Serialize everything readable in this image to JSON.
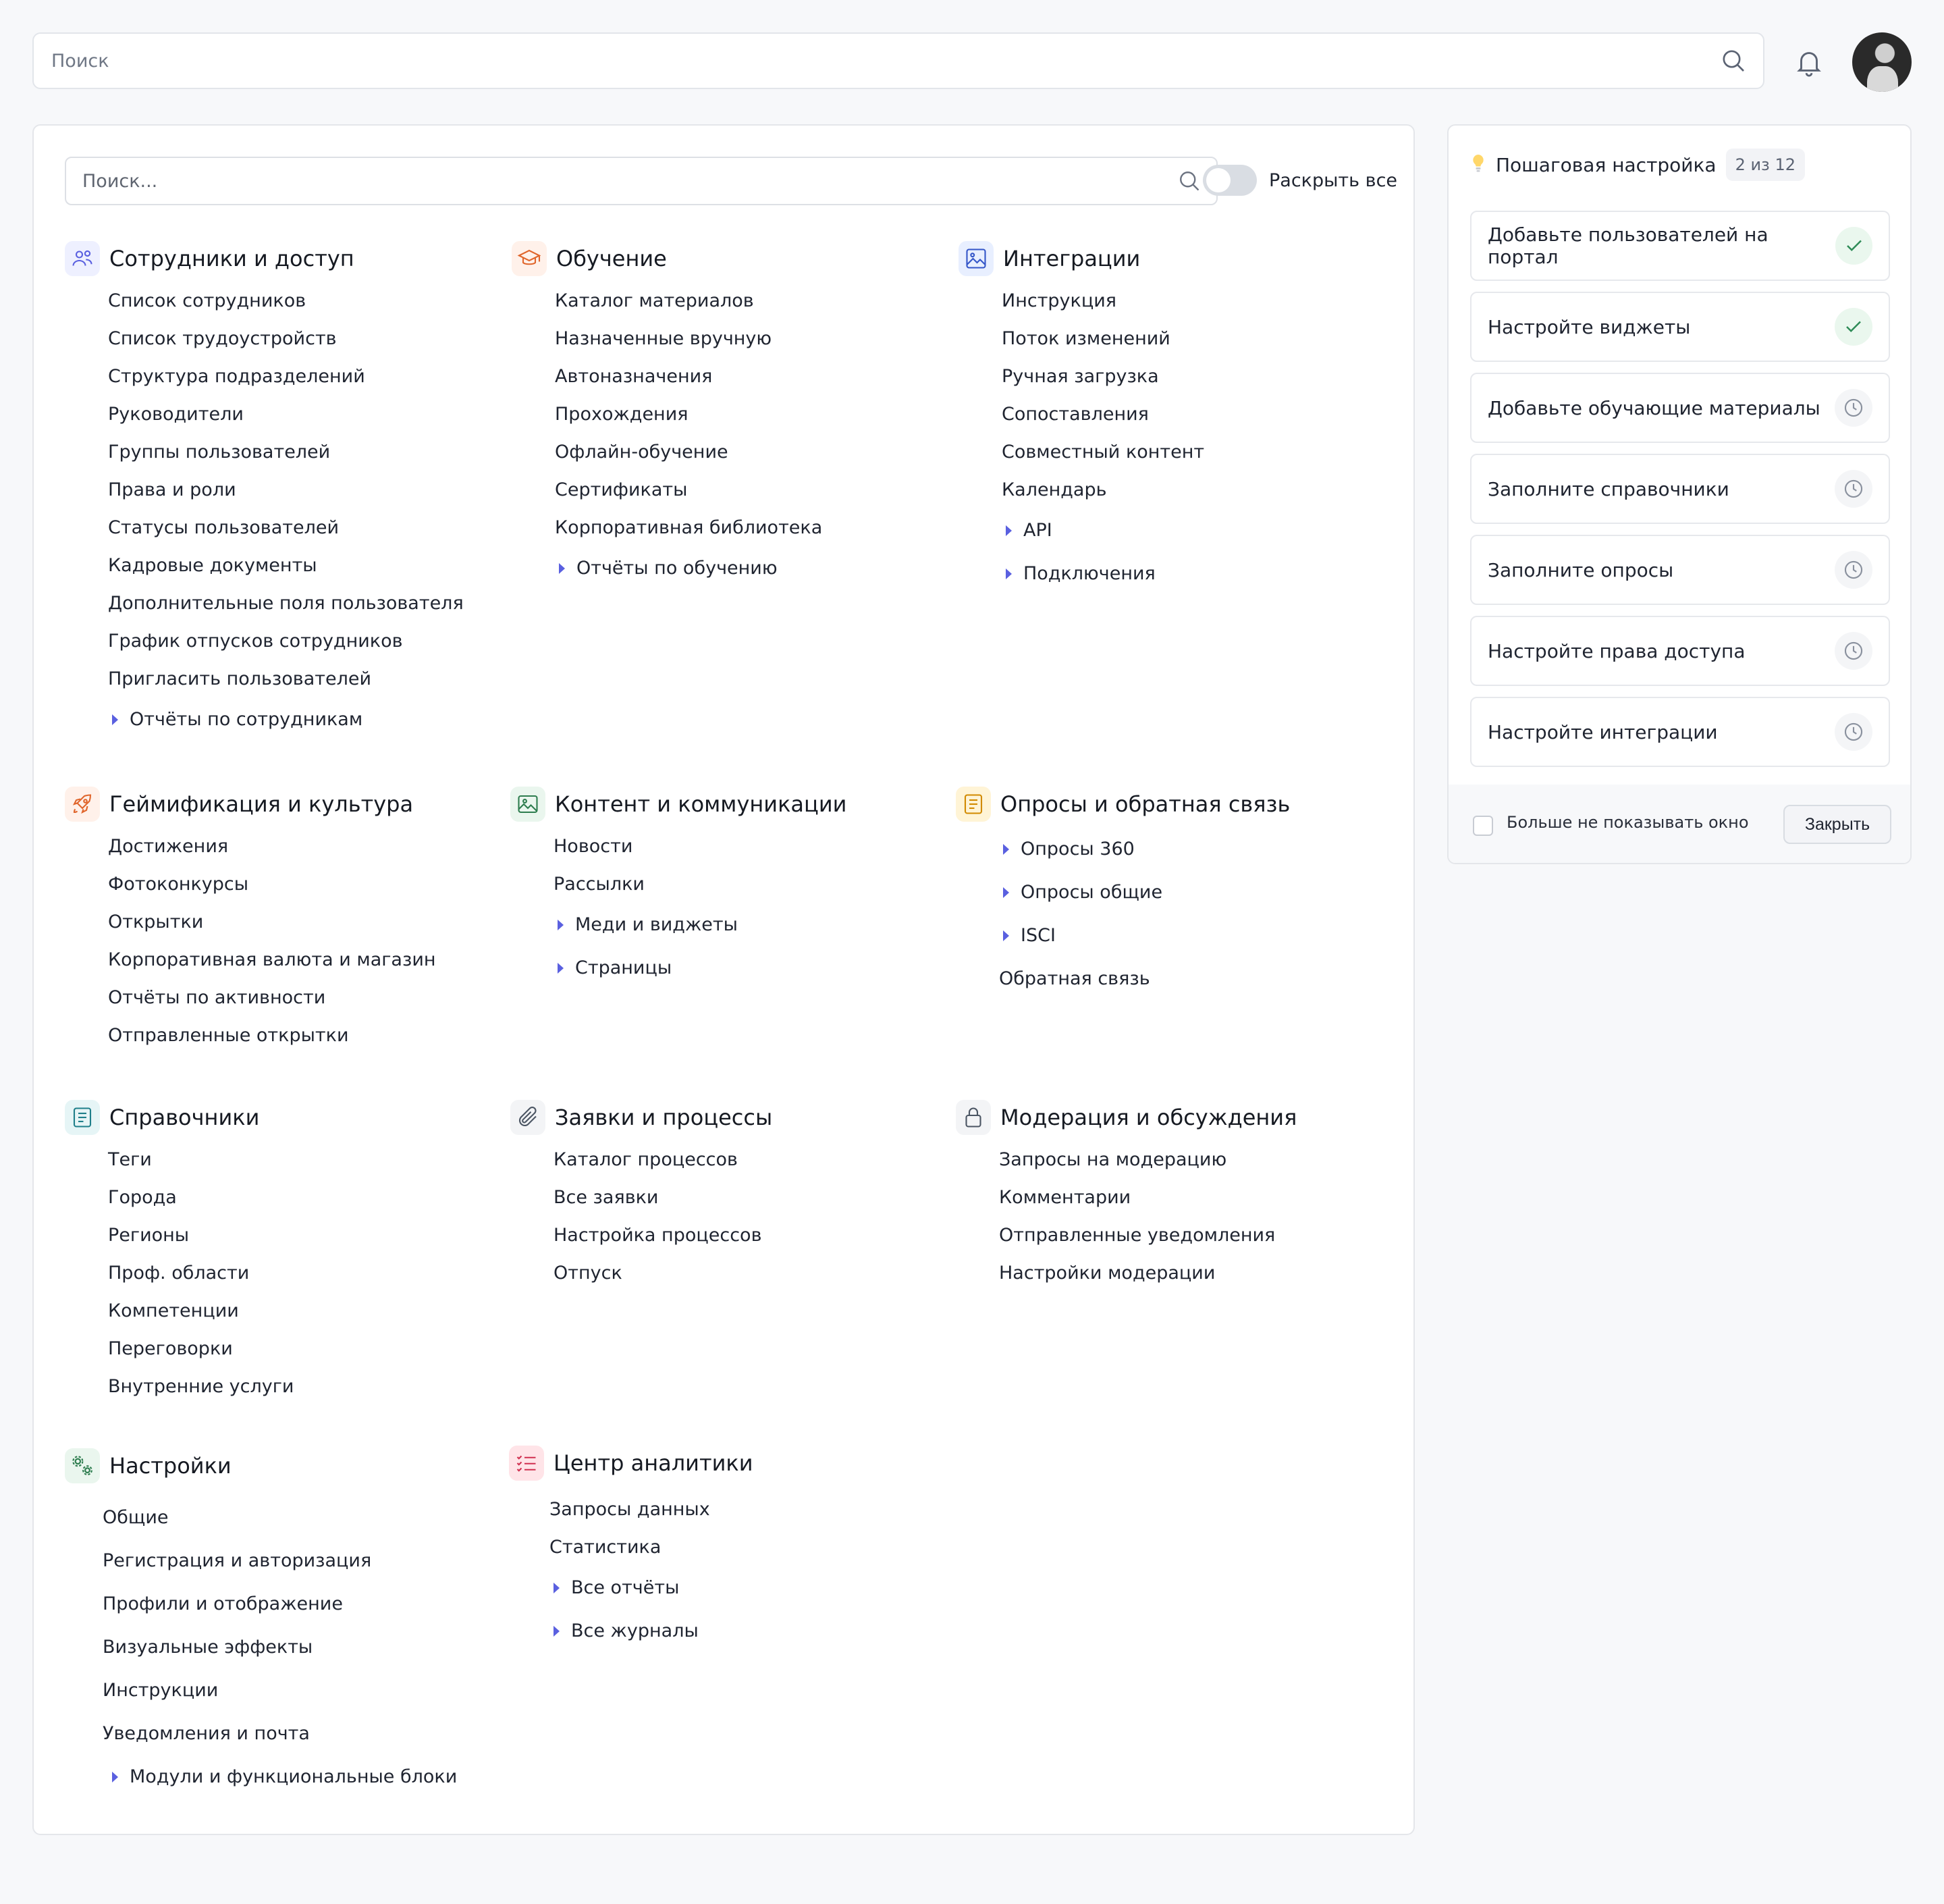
{
  "topbar": {
    "search_placeholder": "Поиск"
  },
  "main": {
    "search_placeholder": "Поиск...",
    "expand_all_label": "Раскрыть все",
    "sections": [
      {
        "id": "employees",
        "title": "Сотрудники и доступ",
        "icon": "users-icon",
        "items": [
          "Список сотрудников",
          "Список трудоустройств",
          "Структура подразделений",
          "Руководители",
          "Группы пользователей",
          "Права и роли",
          "Статусы пользователей",
          "Кадровые документы",
          "Дополнительные поля пользователя",
          "График отпусков сотрудников",
          "Пригласить пользователей"
        ],
        "expandable": [
          "Отчёты по сотрудникам"
        ]
      },
      {
        "id": "learning",
        "title": "Обучение",
        "icon": "graduation-cap-icon",
        "items": [
          "Каталог материалов",
          "Назначенные вручную",
          "Автоназначения",
          "Прохождения",
          "Офлайн-обучение",
          "Сертификаты",
          "Корпоративная библиотека"
        ],
        "expandable": [
          "Отчёты по обучению"
        ]
      },
      {
        "id": "integrations",
        "title": "Интеграции",
        "icon": "image-icon",
        "items": [
          "Инструкция",
          "Поток изменений",
          "Ручная загрузка",
          "Сопоставления",
          "Совместный контент",
          "Календарь"
        ],
        "expandable": [
          "API",
          "Подключения"
        ]
      },
      {
        "id": "gamification",
        "title": "Геймификация и культура",
        "icon": "rocket-icon",
        "items": [
          "Достижения",
          "Фотоконкурсы",
          "Открытки",
          "Корпоративная валюта и магазин",
          "Отчёты по активности",
          "Отправленные открытки"
        ],
        "expandable": []
      },
      {
        "id": "content",
        "title": "Контент и коммуникации",
        "icon": "picture-icon",
        "items": [
          "Новости",
          "Рассылки"
        ],
        "expandable": [
          "Меди и виджеты",
          "Страницы"
        ]
      },
      {
        "id": "surveys",
        "title": "Опросы и обратная связь",
        "icon": "survey-icon",
        "items": [],
        "expandable": [
          "Опросы 360",
          "Опросы общие",
          "ISCI"
        ],
        "after": [
          "Обратная связь"
        ]
      },
      {
        "id": "references",
        "title": "Справочники",
        "icon": "document-icon",
        "items": [
          "Теги",
          "Города",
          "Регионы",
          "Проф. области",
          "Компетенции",
          "Переговорки",
          "Внутренние услуги"
        ],
        "expandable": []
      },
      {
        "id": "requests",
        "title": "Заявки и процессы",
        "icon": "paperclip-icon",
        "items": [
          "Каталог процессов",
          "Все заявки",
          "Настройка процессов",
          "Отпуск"
        ],
        "expandable": []
      },
      {
        "id": "moderation",
        "title": "Модерация и обсуждения",
        "icon": "lock-icon",
        "items": [
          "Запросы на модерацию",
          "Комментарии",
          "Отправленные уведомления",
          "Настройки модерации"
        ],
        "expandable": []
      },
      {
        "id": "settings",
        "title": "Настройки",
        "icon": "gears-icon",
        "items": [],
        "expandable": [],
        "spaced": [
          "Общие",
          "Регистрация и авторизация",
          "Профили и отображение",
          "Визуальные эффекты",
          "Инструкции",
          "Уведомления и почта"
        ],
        "expandable_end": [
          "Модули и функциональные блоки"
        ]
      },
      {
        "id": "analytics",
        "title": "Центр аналитики",
        "icon": "checklist-icon",
        "items": [
          "Запросы данных",
          "Статистика"
        ],
        "expandable": [
          "Все отчёты",
          "Все журналы"
        ]
      }
    ]
  },
  "setup": {
    "title": "Пошаговая настройка",
    "progress": "2 из 12",
    "steps": [
      {
        "label": "Добавьте пользователей на портал",
        "status": "done"
      },
      {
        "label": "Настройте виджеты",
        "status": "done"
      },
      {
        "label": "Добавьте обучающие материалы",
        "status": "pending"
      },
      {
        "label": "Заполните справочники",
        "status": "pending"
      },
      {
        "label": "Заполните опросы",
        "status": "pending"
      },
      {
        "label": "Настройте права доступа",
        "status": "pending"
      },
      {
        "label": "Настройте интеграции",
        "status": "pending"
      }
    ],
    "dont_show_label": "Больше не показывать окно",
    "close_label": "Закрыть"
  },
  "colors": {
    "accent": "#5a60e0",
    "done": "#2e8b57",
    "pending": "#8a919e"
  }
}
